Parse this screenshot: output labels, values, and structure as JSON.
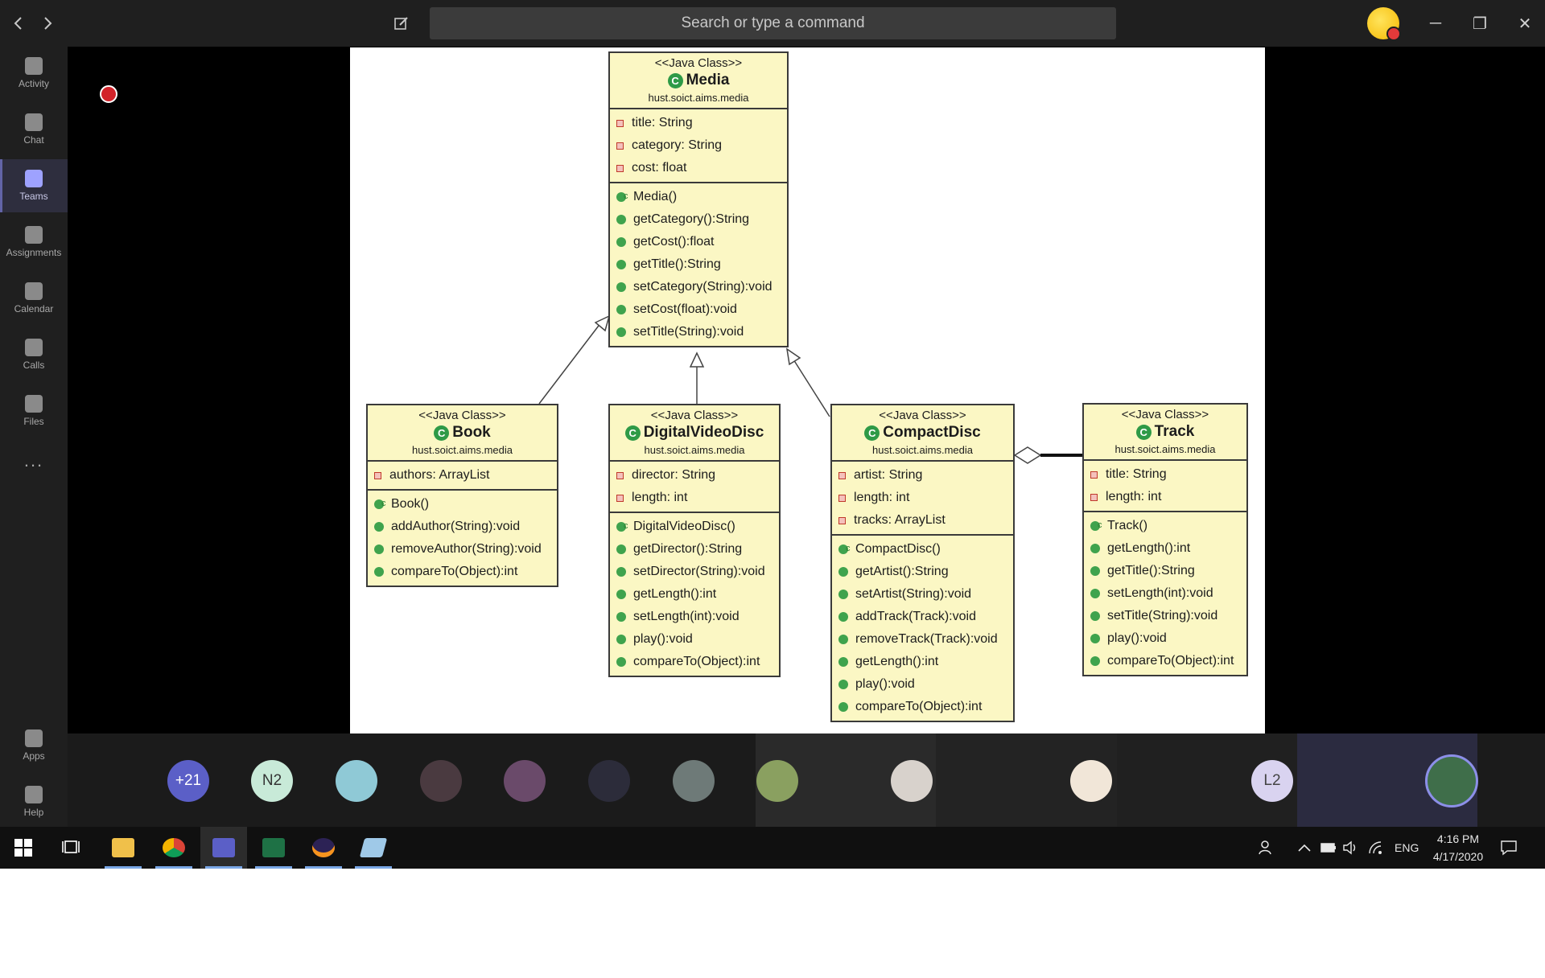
{
  "titlebar": {
    "back_icon": "chevron-left-icon",
    "forward_icon": "chevron-right-icon",
    "compose_icon": "compose-icon",
    "search_placeholder": "Search or type a command",
    "minimize": "─",
    "restore": "❐",
    "close": "✕"
  },
  "rail": {
    "items": [
      {
        "label": "Activity"
      },
      {
        "label": "Chat"
      },
      {
        "label": "Teams"
      },
      {
        "label": "Assignments"
      },
      {
        "label": "Calendar"
      },
      {
        "label": "Calls"
      },
      {
        "label": "Files"
      },
      {
        "label": "..."
      },
      {
        "label": "Apps"
      },
      {
        "label": "Help"
      }
    ],
    "active": "Teams"
  },
  "uml": {
    "stereotype": "<<Java Class>>",
    "package": "hust.soict.aims.media",
    "classes": {
      "media": {
        "name": "Media",
        "fields": [
          "title: String",
          "category: String",
          "cost: float"
        ],
        "constructor": "Media()",
        "methods": [
          "getCategory():String",
          "getCost():float",
          "getTitle():String",
          "setCategory(String):void",
          "setCost(float):void",
          "setTitle(String):void"
        ]
      },
      "book": {
        "name": "Book",
        "fields": [
          "authors: ArrayList"
        ],
        "constructor": "Book()",
        "methods": [
          "addAuthor(String):void",
          "removeAuthor(String):void",
          "compareTo(Object):int"
        ]
      },
      "dvd": {
        "name": "DigitalVideoDisc",
        "fields": [
          "director: String",
          "length: int"
        ],
        "constructor": "DigitalVideoDisc()",
        "methods": [
          "getDirector():String",
          "setDirector(String):void",
          "getLength():int",
          "setLength(int):void",
          "play():void",
          "compareTo(Object):int"
        ]
      },
      "cd": {
        "name": "CompactDisc",
        "fields": [
          "artist: String",
          "length: int",
          "tracks: ArrayList"
        ],
        "constructor": "CompactDisc()",
        "methods": [
          "getArtist():String",
          "setArtist(String):void",
          "addTrack(Track):void",
          "removeTrack(Track):void",
          "getLength():int",
          "play():void",
          "compareTo(Object):int"
        ]
      },
      "track": {
        "name": "Track",
        "fields": [
          "title: String",
          "length: int"
        ],
        "constructor": "Track()",
        "methods": [
          "getLength():int",
          "getTitle():String",
          "setLength(int):void",
          "setTitle(String):void",
          "play():void",
          "compareTo(Object):int"
        ]
      }
    }
  },
  "participants": [
    {
      "label": "+21",
      "color": "#5b5fc7",
      "text_color": "#ffffff"
    },
    {
      "label": "N2",
      "color": "#c8ead8",
      "text_color": "#333333"
    },
    {
      "label": "",
      "color": "#8fc9d6",
      "text_color": "#ffffff"
    },
    {
      "label": "",
      "color": "#4a3a40",
      "text_color": "#ffffff"
    },
    {
      "label": "",
      "color": "#6a4a6a",
      "text_color": "#ffffff"
    },
    {
      "label": "",
      "color": "#2c2c3a",
      "text_color": "#ffffff"
    },
    {
      "label": "",
      "color": "#6e7a78",
      "text_color": "#ffffff"
    },
    {
      "label": "",
      "color": "#8aa060",
      "text_color": "#ffffff"
    },
    {
      "label": "",
      "color": "#d8d2cc",
      "text_color": "#ffffff"
    },
    {
      "label": "",
      "color": "#f1e6d8",
      "text_color": "#ffffff"
    },
    {
      "label": "L2",
      "color": "#d9d3f0",
      "text_color": "#444444"
    },
    {
      "label": "",
      "color": "#3f6e4a",
      "text_color": "#ffffff"
    }
  ],
  "taskbar": {
    "apps": [
      "start-icon",
      "task-view-icon",
      "file-explorer-icon",
      "chrome-icon",
      "teams-icon",
      "excel-icon",
      "eclipse-icon",
      "app-icon"
    ],
    "language": "ENG",
    "time": "4:16 PM",
    "date": "4/17/2020"
  }
}
